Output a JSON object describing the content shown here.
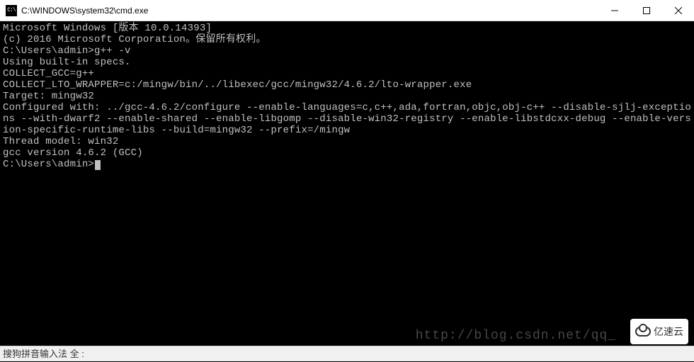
{
  "titlebar": {
    "icon_text": "C:\\",
    "title": "C:\\WINDOWS\\system32\\cmd.exe"
  },
  "terminal": {
    "lines": [
      "Microsoft Windows [版本 10.0.14393]",
      "(c) 2016 Microsoft Corporation。保留所有权利。",
      "",
      "C:\\Users\\admin>g++ -v",
      "Using built-in specs.",
      "COLLECT_GCC=g++",
      "COLLECT_LTO_WRAPPER=c:/mingw/bin/../libexec/gcc/mingw32/4.6.2/lto-wrapper.exe",
      "Target: mingw32",
      "Configured with: ../gcc-4.6.2/configure --enable-languages=c,c++,ada,fortran,objc,obj-c++ --disable-sjlj-exceptions --with-dwarf2 --enable-shared --enable-libgomp --disable-win32-registry --enable-libstdcxx-debug --enable-version-specific-runtime-libs --build=mingw32 --prefix=/mingw",
      "Thread model: win32",
      "gcc version 4.6.2 (GCC)",
      ""
    ],
    "prompt": "C:\\Users\\admin>"
  },
  "ime": {
    "text": "搜狗拼音输入法 全 :"
  },
  "watermark": {
    "text": "http://blog.csdn.net/qq_"
  },
  "logo": {
    "text": "亿速云"
  }
}
